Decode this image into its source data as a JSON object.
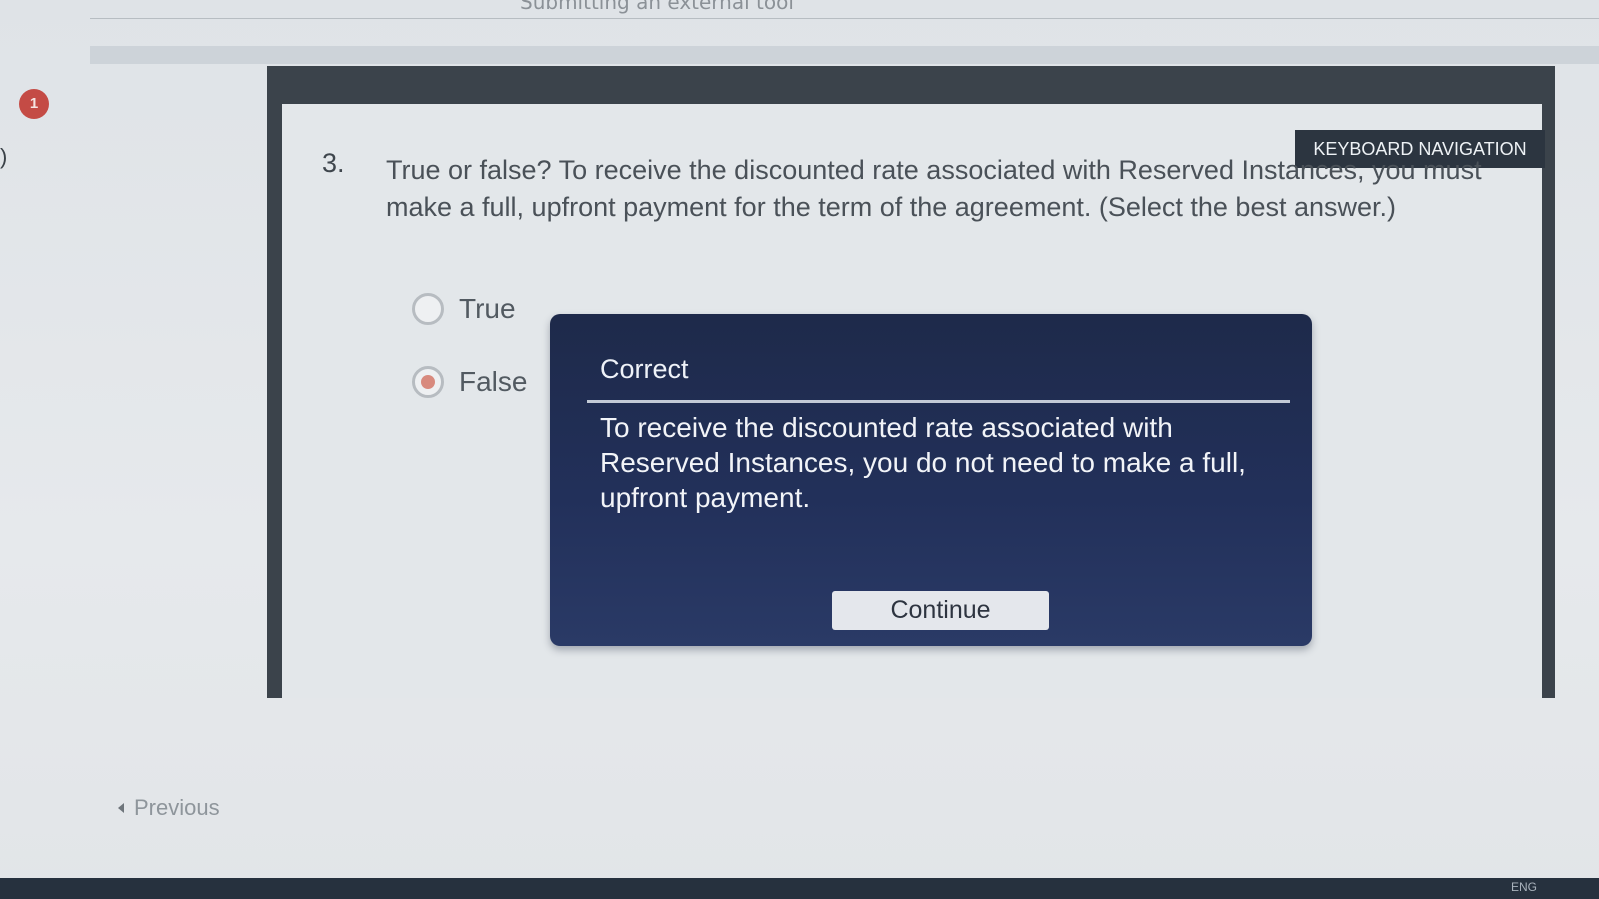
{
  "header": {
    "title": "Submitting an external tool"
  },
  "notification": {
    "count": "1"
  },
  "edge": {
    "glyph": ")"
  },
  "quiz": {
    "keyboard_nav_label": "KEYBOARD NAVIGATION",
    "question_number": "3.",
    "question_text": "True or false? To receive the discounted rate associated with Reserved Instances, you must make a full, upfront payment for the term of the agreement. (Select the best answer.)",
    "options": [
      {
        "label": "True",
        "selected": false
      },
      {
        "label": "False",
        "selected": true
      }
    ],
    "accent_color": "#d88a7e"
  },
  "feedback": {
    "title": "Correct",
    "body": "To receive the discounted rate associated with Reserved Instances, you do not need to make a full, upfront payment.",
    "continue_label": "Continue",
    "background_color": "#22305a"
  },
  "navigation": {
    "previous_label": "Previous"
  },
  "taskbar": {
    "language": "ENG"
  }
}
